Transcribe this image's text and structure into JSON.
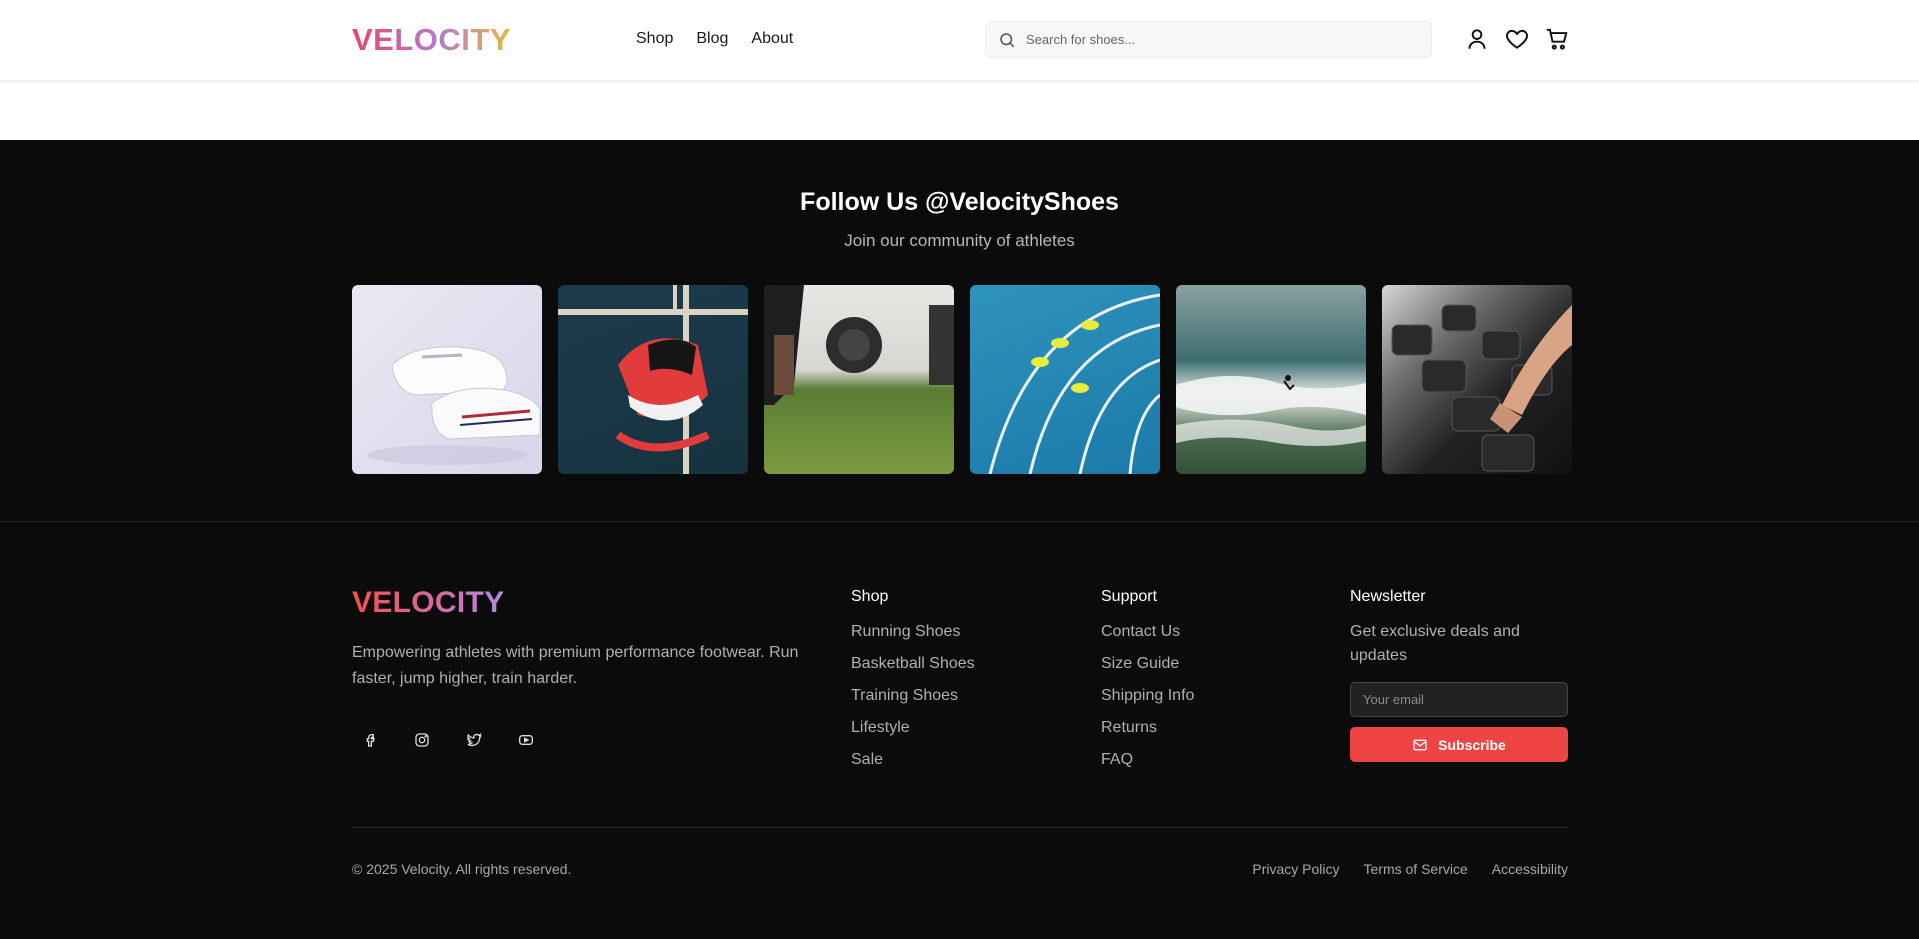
{
  "header": {
    "logo": "VELOCITY",
    "nav": [
      {
        "label": "Shop"
      },
      {
        "label": "Blog"
      },
      {
        "label": "About"
      }
    ],
    "search": {
      "placeholder": "Search for shoes...",
      "icon": "search-icon"
    },
    "icons": [
      "user-icon",
      "heart-icon",
      "cart-icon"
    ]
  },
  "social": {
    "title": "Follow Us @VelocityShoes",
    "subtitle": "Join our community of athletes"
  },
  "footer": {
    "logo": "VELOCITY",
    "tagline": "Empowering athletes with premium performance footwear. Run faster, jump higher, train harder.",
    "social_icons": [
      "facebook-icon",
      "instagram-icon",
      "twitter-icon",
      "youtube-icon"
    ],
    "shop": {
      "heading": "Shop",
      "links": [
        "Running Shoes",
        "Basketball Shoes",
        "Training Shoes",
        "Lifestyle",
        "Sale"
      ]
    },
    "support": {
      "heading": "Support",
      "links": [
        "Contact Us",
        "Size Guide",
        "Shipping Info",
        "Returns",
        "FAQ"
      ]
    },
    "newsletter": {
      "heading": "Newsletter",
      "text": "Get exclusive deals and updates",
      "placeholder": "Your email",
      "button": "Subscribe"
    },
    "copyright": "© 2025 Velocity. All rights reserved.",
    "legal": [
      "Privacy Policy",
      "Terms of Service",
      "Accessibility"
    ]
  },
  "colors": {
    "accent": "#ef4444",
    "background": "#0b0b0b"
  }
}
